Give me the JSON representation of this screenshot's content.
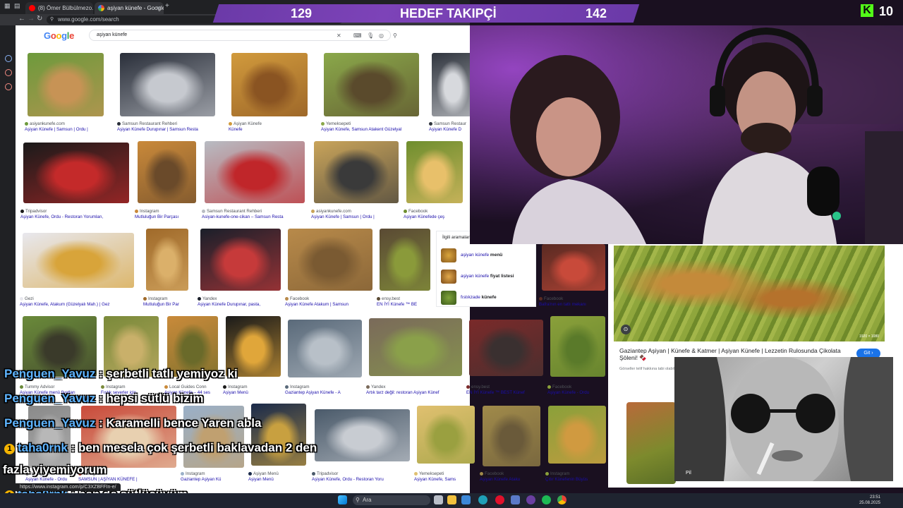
{
  "browser": {
    "tabs": [
      {
        "label": "(8) Ömer Bülbülmezo...",
        "active": false
      },
      {
        "label": "aşiyan künefe - Google'd...",
        "active": true
      }
    ],
    "url": "www.google.com/search",
    "status_url": "https://www.instagram.com/p/C3XZBFFIn-e/"
  },
  "google": {
    "logo": "Google",
    "query": "aşiyan künefe",
    "results": [
      {
        "src": "asiyankunefe.com",
        "title": "Aşiyan Künefe | Samsun | Ordu |"
      },
      {
        "src": "Samsun Restaurant Rehberi",
        "title": "Aşiyan Künefe Durupınar | Samsun Resta"
      },
      {
        "src": "Aşiyan Künefe",
        "title": "Künefe"
      },
      {
        "src": "Yemeksepeti",
        "title": "Aşiyan Künefe, Samsun Atakent Güzelyal"
      },
      {
        "src": "Samsun Restaur",
        "title": "Aşiyan Künefe D"
      },
      {
        "src": "Tripadvisor",
        "title": "Aşiyan Künefe, Ordu - Restoran Yorumları,"
      },
      {
        "src": "Instagram",
        "title": "Mutluluğun Bir Parçası"
      },
      {
        "src": "Samsun Restaurant Rehberi",
        "title": "Asiyan-kunefe-one-cikan – Samsun Resta"
      },
      {
        "src": "asiyankunefe.com",
        "title": "Aşiyan Künefe | Samsun | Ordu |"
      },
      {
        "src": "Facebook",
        "title": "Aşiyan Künefede çeş"
      },
      {
        "src": "Gezi",
        "title": "Aşiyan Künefe, Atakum (Güzelyalı Mah.) | Gez"
      },
      {
        "src": "Instagram",
        "title": "Mutluluğun Bir Par"
      },
      {
        "src": "Yandex",
        "title": "Aşiyan Künefe Durupınar, pasta,"
      },
      {
        "src": "Facebook",
        "title": "Aşiyan Künefe Atakum | Samsun"
      },
      {
        "src": "ensy.best",
        "title": "EN İYİ Künefe ™ BE"
      },
      {
        "src": "Facebook",
        "title": "Bafra'nın en tatlı mekanı"
      },
      {
        "src": "Tummy Advisor",
        "title": "Aşiyan Künefe menü fiyatları"
      },
      {
        "src": "Instagram",
        "title": "Fıstık severler için"
      },
      {
        "src": "Local Guides Conn",
        "title": "Aşiyan Künefe – 44 ses"
      },
      {
        "src": "Instagram",
        "title": "Aşiyan Menü"
      },
      {
        "src": "Instagram",
        "title": "Gaziantep Aşiyan Künefe - A"
      },
      {
        "src": "Yandex",
        "title": "Artık tarz değil: restoran Aşiyan Künef"
      },
      {
        "src": "ensy.best",
        "title": "EN İYİ Künefe ™ BEST Künef"
      },
      {
        "src": "Facebook",
        "title": "Aşiyan Künefe - Ordu"
      },
      {
        "src": "Instagram",
        "title": "Aşiyan Künefe - Ordu"
      },
      {
        "src": "Instagram",
        "title": "SAMSUN | AŞİYAN KÜNEFE |"
      },
      {
        "src": "Instagram",
        "title": "Gaziantep Aşiyan Kü"
      },
      {
        "src": "Aşiyan Menü",
        "title": "Aşiyan Menü"
      },
      {
        "src": "Tripadvisor",
        "title": "Aşiyan Künefe, Ordu - Restoran Yoru"
      },
      {
        "src": "Yemeksepeti",
        "title": "Aşiyan Künefe, Sams"
      },
      {
        "src": "Facebook",
        "title": "Aşiyan Künefe Ataku"
      },
      {
        "src": "Instagram",
        "title": "Çıtır Künefenin Büyüs"
      }
    ],
    "related": {
      "header": "İlgili aramalar",
      "items": [
        {
          "prefix": "aşiyan künefe ",
          "bold": "menü"
        },
        {
          "prefix": "aşiyan künefe ",
          "bold": "fiyat listesi"
        },
        {
          "prefix": "fıstıkzade ",
          "bold": "künefe"
        }
      ]
    },
    "preview": {
      "title": "Gaziantep Aşiyan | Künefe & Katmer | Aşiyan Künefe | Lezzetin Rulosunda Çikolata Şöleni! 🍫",
      "button": "Git ›",
      "snippet": "Görseller telif hakkına tabi olabilir.",
      "resolution": "1920 × 1080"
    }
  },
  "overlay": {
    "goal_current": "129",
    "goal_label": "HEDEF TAKIPÇİ",
    "goal_target": "142",
    "kick_viewers": "10",
    "kick_logo": "K",
    "ad_corner": "Pil"
  },
  "chat": [
    {
      "user": "Penguen_Yavuz",
      "text": " : şerbetli tatlı yemiyoz ki",
      "badge": false
    },
    {
      "user": "Penguen_Yavuz",
      "text": " : hepsi sütlü bizim",
      "badge": false
    },
    {
      "user": "Penguen_Yavuz",
      "text": " : Karamelli bence Yaren abla",
      "badge": false
    },
    {
      "user": "taha0rnk",
      "text": " : ben mesela çok şerbetli baklavadan 2 den",
      "badge": true
    },
    {
      "user": "",
      "text": "fazla yiyemiyorum",
      "badge": false
    },
    {
      "user": "taha0rnk",
      "text": " : ben de sütlücüyüm",
      "badge": true
    }
  ],
  "taskbar": {
    "search_label": "Ara",
    "time": "23:51",
    "date": "25.08.2025"
  },
  "colors": {
    "goal_bar": "#6b3aa8",
    "kick_green": "#53fc18",
    "chat_user": "#5eb4ff",
    "google_link": "#1a0dab"
  }
}
